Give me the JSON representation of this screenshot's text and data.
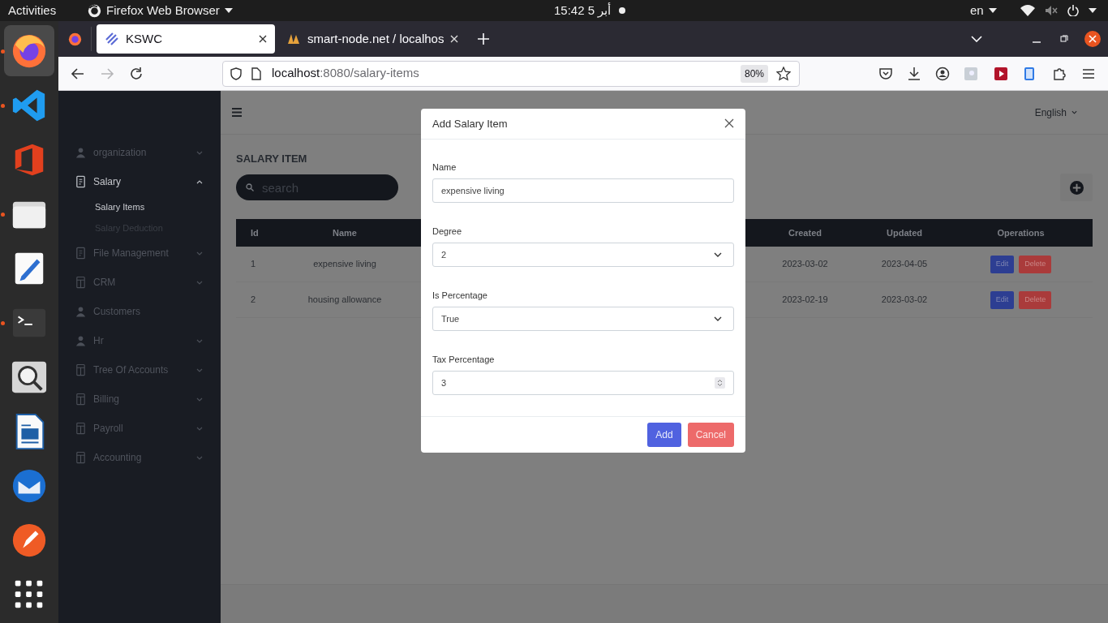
{
  "top_bar": {
    "activities": "Activities",
    "app_menu": "Firefox Web Browser",
    "clock": "15:42  أبر 5",
    "keyboard_layout": "en",
    "muted": true
  },
  "dock": [
    {
      "kind": "browser",
      "running": true,
      "selected": true
    },
    {
      "kind": "code-editor",
      "running": true,
      "selected": false
    },
    {
      "kind": "office",
      "running": false,
      "selected": false
    },
    {
      "kind": "files",
      "running": true,
      "selected": false
    },
    {
      "kind": "text-editor",
      "running": false,
      "selected": false
    },
    {
      "kind": "terminal",
      "running": true,
      "selected": false
    },
    {
      "kind": "magnifier",
      "running": false,
      "selected": false
    },
    {
      "kind": "document",
      "running": false,
      "selected": false
    },
    {
      "kind": "mail",
      "running": false,
      "selected": false
    },
    {
      "kind": "pen",
      "running": false,
      "selected": false
    },
    {
      "kind": "app-grid",
      "running": false,
      "selected": false
    }
  ],
  "browser": {
    "tabs": [
      {
        "title": "KSWC",
        "selected": true
      },
      {
        "title": "smart-node.net / localhos",
        "selected": false
      }
    ],
    "url_host": "localhost",
    "url_path": ":8080/salary-items",
    "zoom": "80%"
  },
  "app": {
    "language": "English",
    "sidebar": [
      {
        "label": "organization",
        "kind": "person",
        "selected": false,
        "expanded": false
      },
      {
        "label": "Salary",
        "kind": "document",
        "selected": true,
        "expanded": true,
        "children": [
          {
            "label": "Salary Items",
            "selected": true
          },
          {
            "label": "Salary Deduction",
            "selected": false
          }
        ]
      },
      {
        "label": "File Management",
        "kind": "document",
        "selected": false,
        "expanded": false
      },
      {
        "label": "CRM",
        "kind": "panel",
        "selected": false,
        "expanded": false
      },
      {
        "label": "Customers",
        "kind": "person",
        "selected": false
      },
      {
        "label": "Hr",
        "kind": "person",
        "selected": false,
        "expanded": false
      },
      {
        "label": "Tree Of Accounts",
        "kind": "panel",
        "selected": false,
        "expanded": false
      },
      {
        "label": "Billing",
        "kind": "panel",
        "selected": false,
        "expanded": false
      },
      {
        "label": "Payroll",
        "kind": "panel",
        "selected": false,
        "expanded": false
      },
      {
        "label": "Accounting",
        "kind": "panel",
        "selected": false,
        "expanded": false
      }
    ],
    "page_title": "SALARY ITEM",
    "search": {
      "placeholder": "search"
    },
    "table": {
      "columns": [
        "Id",
        "Name",
        "Created",
        "Updated",
        "Operations"
      ],
      "rows": [
        {
          "id": "1",
          "name": "expensive living",
          "created": "2023-03-02",
          "updated": "2023-04-05",
          "actions": [
            "Edit",
            "Delete"
          ]
        },
        {
          "id": "2",
          "name": "housing allowance",
          "created": "2023-02-19",
          "updated": "2023-03-02",
          "actions": [
            "Edit",
            "Delete"
          ]
        }
      ]
    }
  },
  "dialog": {
    "title": "Add Salary Item",
    "fields": [
      {
        "label": "Name",
        "kind": "text",
        "value": "expensive living"
      },
      {
        "label": "Degree",
        "kind": "select",
        "value": "2"
      },
      {
        "label": "Is Percentage",
        "kind": "select",
        "value": "True"
      },
      {
        "label": "Tax Percentage",
        "kind": "number",
        "value": "3"
      }
    ],
    "buttons": [
      {
        "label": "Add",
        "kind": "primary"
      },
      {
        "label": "Cancel",
        "kind": "danger"
      }
    ]
  }
}
